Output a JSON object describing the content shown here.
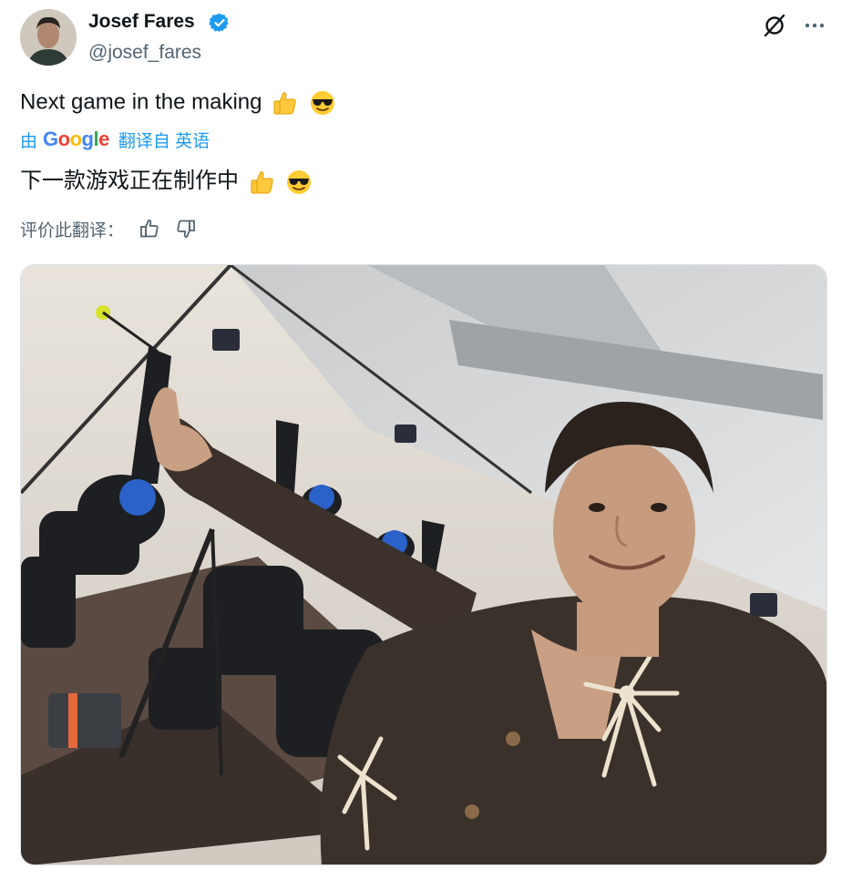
{
  "author": {
    "display_name": "Josef Fares",
    "handle": "@josef_fares",
    "avatar_icon": "person-avatar",
    "verified_icon": "verified-badge-icon"
  },
  "header_actions": {
    "grok_icon": "grok-icon",
    "more_icon": "more-options-icon"
  },
  "tweet": {
    "text": "Next game in the making",
    "emojis": [
      "thumbs-up",
      "smiling-face-with-sunglasses"
    ]
  },
  "translation": {
    "by_label": "由",
    "google_label": "Google",
    "translated_from_label": "翻译自 英语",
    "translated_text": "下一款游戏正在制作中"
  },
  "rating": {
    "prompt": "评价此翻译：",
    "thumbs_up_icon": "thumbs-up-outline-icon",
    "thumbs_down_icon": "thumbs-down-outline-icon"
  },
  "media": {
    "type": "photo",
    "description_icon": "tweet-photo"
  },
  "colors": {
    "accent": "#1d9bf0",
    "text": "#0f1419",
    "secondary_text": "#536471",
    "google_blue": "#4285f4",
    "google_red": "#ea4335",
    "google_yellow": "#fbbc05",
    "google_green": "#34a853"
  }
}
